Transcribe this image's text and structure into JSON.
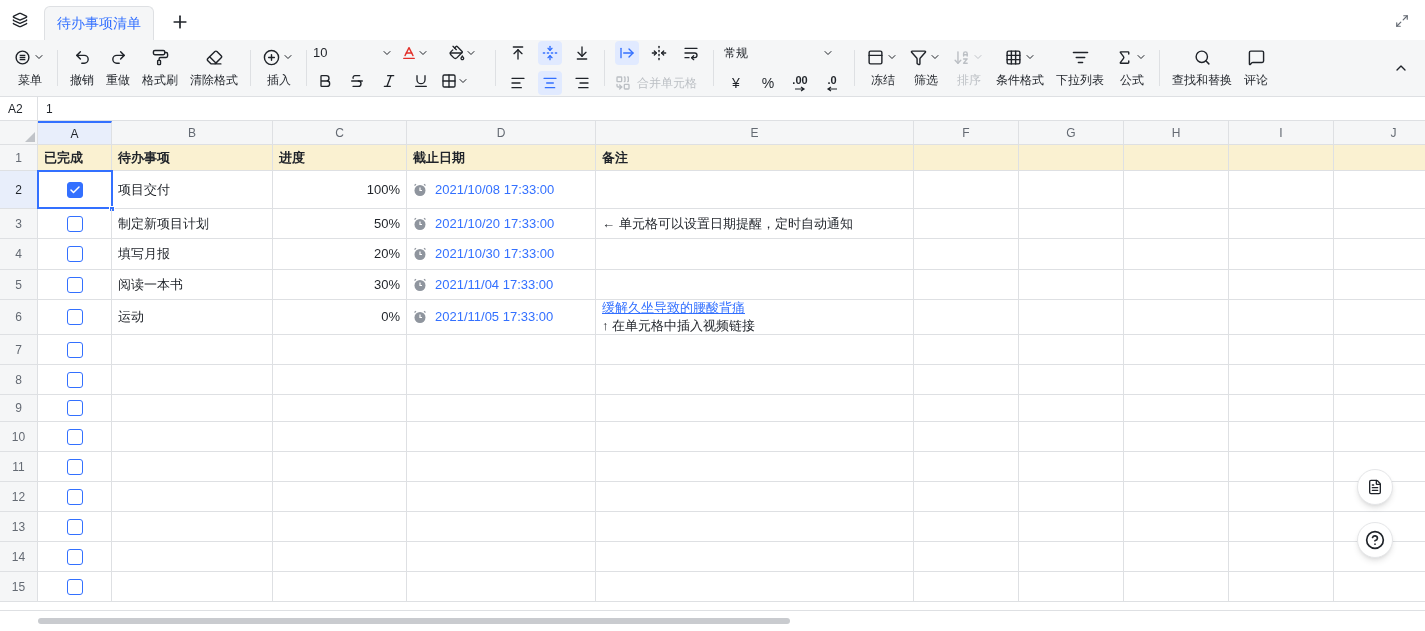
{
  "tabs": [
    {
      "label": "待办事项清单",
      "selected": true
    }
  ],
  "toolbar": [
    {
      "kind": "labeled",
      "items": [
        {
          "label": "菜单",
          "dropdown": true,
          "disabled": false
        }
      ]
    },
    {
      "kind": "labeled",
      "items": [
        {
          "label": "撤销",
          "dropdown": false,
          "disabled": false
        },
        {
          "label": "重做",
          "dropdown": false,
          "disabled": false
        },
        {
          "label": "格式刷",
          "dropdown": false,
          "disabled": false
        },
        {
          "label": "清除格式",
          "dropdown": false,
          "disabled": false
        }
      ]
    },
    {
      "kind": "labeled",
      "items": [
        {
          "label": "插入",
          "dropdown": true,
          "disabled": false
        }
      ]
    },
    {
      "kind": "font",
      "size": "10"
    },
    {
      "kind": "align",
      "top": [
        {
          "selected": false
        },
        {
          "selected": true
        },
        {
          "selected": false
        }
      ],
      "bottom": [
        {
          "selected": false
        },
        {
          "selected": true
        },
        {
          "selected": false
        }
      ]
    },
    {
      "kind": "wrap",
      "buttons": [
        {
          "selected": true
        },
        {
          "selected": false
        },
        {
          "selected": false
        }
      ],
      "merge": {
        "label": "合并单元格",
        "disabled": true
      }
    },
    {
      "kind": "number",
      "format": "常规",
      "buttons": [
        "¥",
        "%",
        ".00",
        ".0"
      ]
    },
    {
      "kind": "labeled",
      "items": [
        {
          "label": "冻结",
          "dropdown": true,
          "disabled": false
        },
        {
          "label": "筛选",
          "dropdown": true,
          "disabled": false
        },
        {
          "label": "排序",
          "dropdown": true,
          "disabled": true
        },
        {
          "label": "条件格式",
          "dropdown": true,
          "disabled": false
        },
        {
          "label": "下拉列表",
          "dropdown": false,
          "disabled": false
        },
        {
          "label": "公式",
          "dropdown": true,
          "disabled": false
        }
      ]
    },
    {
      "kind": "labeled",
      "items": [
        {
          "label": "查找和替换",
          "dropdown": false,
          "disabled": false
        },
        {
          "label": "评论",
          "dropdown": false,
          "disabled": false
        }
      ]
    }
  ],
  "formula_bar": {
    "cell": "A2",
    "value": "1"
  },
  "sheet": {
    "columns": [
      {
        "label": "A",
        "selected": true
      },
      {
        "label": "B",
        "selected": false
      },
      {
        "label": "C",
        "selected": false
      },
      {
        "label": "D",
        "selected": false
      },
      {
        "label": "E",
        "selected": false
      },
      {
        "label": "F",
        "selected": false
      },
      {
        "label": "G",
        "selected": false
      },
      {
        "label": "H",
        "selected": false
      },
      {
        "label": "I",
        "selected": false
      },
      {
        "label": "J",
        "selected": false
      }
    ],
    "rows": [
      {
        "number": "1",
        "kind": "header",
        "selected": false,
        "cells": [
          "已完成",
          "待办事项",
          "进度",
          "截止日期",
          "备注"
        ]
      },
      {
        "number": "2",
        "kind": "task",
        "selected": true,
        "done": true,
        "task": "项目交付",
        "progress": "100%",
        "due": "2021/10/08 17:33:00"
      },
      {
        "number": "3",
        "kind": "task",
        "selected": false,
        "done": false,
        "task": "制定新项目计划",
        "progress": "50%",
        "due": "2021/10/20 17:33:00",
        "note": "← 单元格可以设置日期提醒，定时自动通知"
      },
      {
        "number": "4",
        "kind": "task",
        "selected": false,
        "done": false,
        "task": "填写月报",
        "progress": "20%",
        "due": "2021/10/30 17:33:00"
      },
      {
        "number": "5",
        "kind": "task",
        "selected": false,
        "done": false,
        "task": "阅读一本书",
        "progress": "30%",
        "due": "2021/11/04 17:33:00"
      },
      {
        "number": "6",
        "kind": "task",
        "selected": false,
        "done": false,
        "task": "运动",
        "progress": "0%",
        "due": "2021/11/05 17:33:00",
        "note_link": "缓解久坐导致的腰酸背痛",
        "note": "↑ 在单元格中插入视频链接"
      },
      {
        "number": "7",
        "kind": "blank",
        "selected": false,
        "done": false
      },
      {
        "number": "8",
        "kind": "blank",
        "selected": false,
        "done": false
      },
      {
        "number": "9",
        "kind": "blank",
        "selected": false,
        "done": false
      },
      {
        "number": "10",
        "kind": "blank",
        "selected": false,
        "done": false
      },
      {
        "number": "11",
        "kind": "blank",
        "selected": false,
        "done": false
      },
      {
        "number": "12",
        "kind": "blank",
        "selected": false,
        "done": false
      },
      {
        "number": "13",
        "kind": "blank",
        "selected": false,
        "done": false
      },
      {
        "number": "14",
        "kind": "blank",
        "selected": false,
        "done": false
      },
      {
        "number": "15",
        "kind": "blank",
        "selected": false,
        "done": false
      }
    ]
  }
}
